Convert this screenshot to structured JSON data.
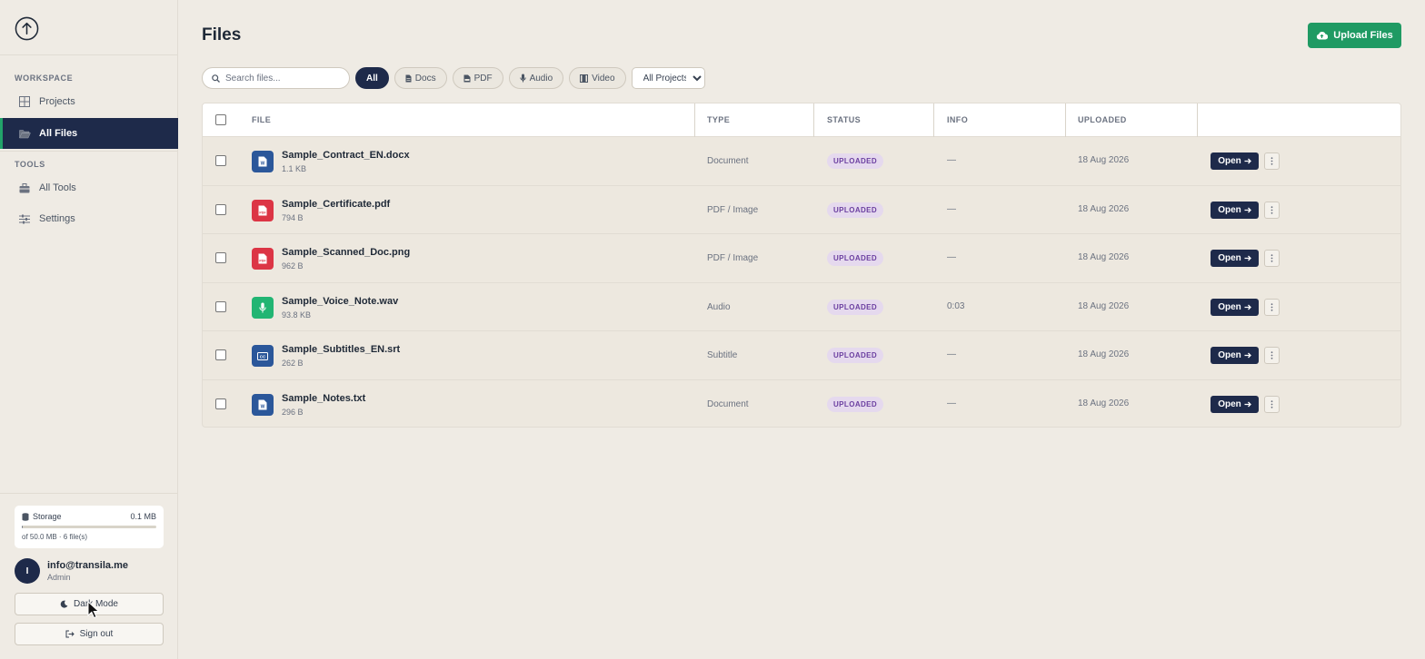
{
  "sidebar": {
    "sections": {
      "workspace": "WORKSPACE",
      "tools": "TOOLS"
    },
    "items": [
      {
        "label": "Projects",
        "icon": "grid-icon",
        "active": false
      },
      {
        "label": "All Files",
        "icon": "folder-open-icon",
        "active": true
      },
      {
        "label": "All Tools",
        "icon": "toolbox-icon",
        "active": false
      },
      {
        "label": "Settings",
        "icon": "sliders-icon",
        "active": false
      }
    ],
    "storage": {
      "label": "Storage",
      "used": "0.1 MB",
      "detail": "of 50.0 MB · 6 file(s)",
      "used_fraction": 0.002
    },
    "user": {
      "initial": "I",
      "email": "info@transila.me",
      "role": "Admin"
    },
    "dark_mode_label": "Dark Mode",
    "sign_out_label": "Sign out"
  },
  "header": {
    "title": "Files",
    "upload_label": "Upload Files"
  },
  "filters": {
    "search_placeholder": "Search files...",
    "chips": [
      {
        "label": "All",
        "icon": "",
        "active": true
      },
      {
        "label": "Docs",
        "icon": "document-icon",
        "active": false
      },
      {
        "label": "PDF",
        "icon": "pdf-icon",
        "active": false
      },
      {
        "label": "Audio",
        "icon": "microphone-icon",
        "active": false
      },
      {
        "label": "Video",
        "icon": "film-icon",
        "active": false
      }
    ],
    "project_select": "All Projects"
  },
  "table": {
    "columns": [
      "FILE",
      "TYPE",
      "STATUS",
      "INFO",
      "UPLOADED"
    ],
    "open_label": "Open",
    "rows": [
      {
        "name": "Sample_Contract_EN.docx",
        "size": "1.1 KB",
        "type": "Document",
        "status": "UPLOADED",
        "info": "—",
        "uploaded": "18 Aug 2026",
        "icon": "word-doc-icon",
        "icon_color": "#2b579a"
      },
      {
        "name": "Sample_Certificate.pdf",
        "size": "794 B",
        "type": "PDF / Image",
        "status": "UPLOADED",
        "info": "—",
        "uploaded": "18 Aug 2026",
        "icon": "pdf-file-icon",
        "icon_color": "#dc3545"
      },
      {
        "name": "Sample_Scanned_Doc.png",
        "size": "962 B",
        "type": "PDF / Image",
        "status": "UPLOADED",
        "info": "—",
        "uploaded": "18 Aug 2026",
        "icon": "pdf-file-icon",
        "icon_color": "#dc3545"
      },
      {
        "name": "Sample_Voice_Note.wav",
        "size": "93.8 KB",
        "type": "Audio",
        "status": "UPLOADED",
        "info": "0:03",
        "uploaded": "18 Aug 2026",
        "icon": "microphone-file-icon",
        "icon_color": "#22b573"
      },
      {
        "name": "Sample_Subtitles_EN.srt",
        "size": "262 B",
        "type": "Subtitle",
        "status": "UPLOADED",
        "info": "—",
        "uploaded": "18 Aug 2026",
        "icon": "cc-file-icon",
        "icon_color": "#2b579a"
      },
      {
        "name": "Sample_Notes.txt",
        "size": "296 B",
        "type": "Document",
        "status": "UPLOADED",
        "info": "—",
        "uploaded": "18 Aug 2026",
        "icon": "word-doc-icon",
        "icon_color": "#2b579a"
      }
    ]
  }
}
